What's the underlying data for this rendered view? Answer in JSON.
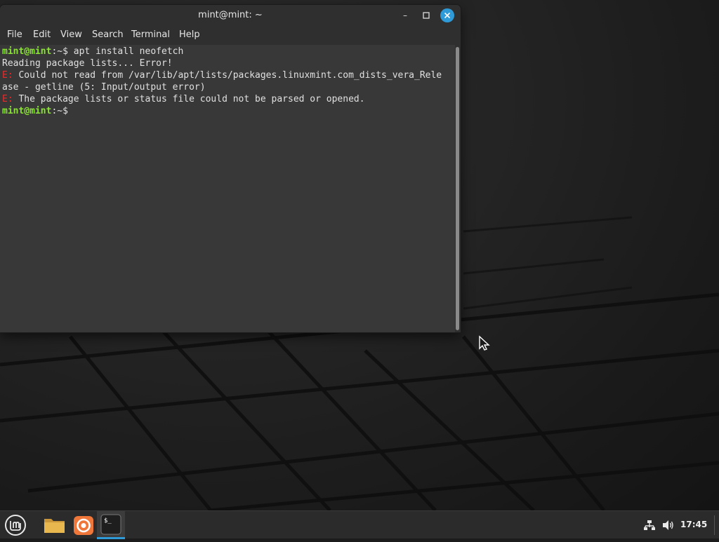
{
  "window": {
    "title": "mint@mint: ~",
    "controls": {
      "minimize": "–",
      "maximize": "□",
      "close": "✕"
    }
  },
  "menu": [
    "File",
    "Edit",
    "View",
    "Search",
    "Terminal",
    "Help"
  ],
  "terminal": {
    "prompt_user": "mint@mint",
    "prompt_path": ":~$ ",
    "command": "apt install neofetch",
    "output_1": "Reading package lists... Error!",
    "error_prefix": "E:",
    "error_1a": " Could not read from /var/lib/apt/lists/packages.linuxmint.com_dists_vera_Rele",
    "error_1b": "ase - getline (5: Input/output error)",
    "error_2": " The package lists or status file could not be parsed or opened.",
    "prompt_path_2": ":~$"
  },
  "taskbar": {
    "clock": "17:45",
    "icons": [
      "mint-menu-icon",
      "files-icon",
      "firefox-icon",
      "terminal-icon",
      "network-icon",
      "volume-icon"
    ]
  },
  "colors": {
    "accent": "#2e9ad8",
    "prompt_green": "#8ae234",
    "error_red": "#ef2929",
    "terminal_bg": "#383838"
  }
}
